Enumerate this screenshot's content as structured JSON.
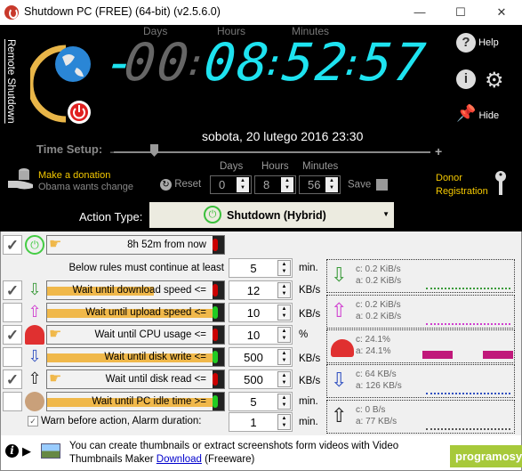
{
  "window": {
    "title": "Shutdown PC (FREE) (64-bit) (v2.5.6.0)",
    "minimize": "—",
    "maximize": "☐",
    "close": "✕"
  },
  "header": {
    "remote_shutdown": "Remote Shutdown",
    "labels": {
      "days": "Days",
      "hours": "Hours",
      "minutes": "Minutes"
    },
    "countdown": {
      "sign": "-",
      "days": "00",
      "hours": "08",
      "minutes": "52",
      "seconds": "57",
      "sep": ":"
    },
    "date": "sobota, 20 lutego 2016 23:30",
    "help": "Help",
    "hide": "Hide",
    "time_setup": "Time Setup:",
    "slider_minus": "–",
    "slider_plus": "+",
    "donation_title": "Make  a donation",
    "donation_sub": "Obama  wants change",
    "reset": "Reset",
    "spin": {
      "days_label": "Days",
      "days": "0",
      "hours_label": "Hours",
      "hours": "8",
      "minutes_label": "Minutes",
      "minutes": "56"
    },
    "save": "Save",
    "donor": "Donor",
    "registration": "Registration",
    "action_type_label": "Action Type:",
    "action_type_value": "Shutdown (Hybrid)"
  },
  "rules": {
    "timer_rule": {
      "checked": true,
      "text": "8h 52m from now",
      "status": "red"
    },
    "continue_label": "Below rules must continue at least",
    "continue_value": "5",
    "continue_unit": "min.",
    "items": [
      {
        "name": "download",
        "checked": true,
        "text": "Wait until download speed <=",
        "value": "12",
        "unit": "KB/s",
        "status": "red"
      },
      {
        "name": "upload",
        "checked": false,
        "text": "Wait until upload speed <=",
        "value": "10",
        "unit": "KB/s",
        "status": "green"
      },
      {
        "name": "cpu",
        "checked": true,
        "text": "Wait until CPU usage <=",
        "value": "10",
        "unit": "%",
        "status": "red"
      },
      {
        "name": "disk-write",
        "checked": false,
        "text": "Wait until disk write <=",
        "value": "500",
        "unit": "KB/s",
        "status": "green"
      },
      {
        "name": "disk-read",
        "checked": true,
        "text": "Wait until disk read <=",
        "value": "500",
        "unit": "KB/s",
        "status": "red"
      },
      {
        "name": "idle",
        "checked": false,
        "text": "Wait until PC idle time >=",
        "value": "5",
        "unit": "min.",
        "status": "green"
      }
    ],
    "warn_checked": true,
    "warn_label": "Warn before action, Alarm duration:",
    "warn_value": "1",
    "warn_unit": "min."
  },
  "monitors": [
    {
      "name": "download",
      "c": "c: 0.2 KiB/s",
      "a": "a: 0.2 KiB/s",
      "color": "#3a9a3a"
    },
    {
      "name": "upload",
      "c": "c: 0.2 KiB/s",
      "a": "a: 0.2 KiB/s",
      "color": "#d040d0"
    },
    {
      "name": "cpu",
      "c": "c: 24.1%",
      "a": "a: 24.1%",
      "color": "#c0187a"
    },
    {
      "name": "disk-write",
      "c": "c: 64 KB/s",
      "a": "a: 126 KB/s",
      "color": "#3050c0"
    },
    {
      "name": "disk-read",
      "c": "c: 0 B/s",
      "a": "a: 77 KB/s",
      "color": "#555555"
    }
  ],
  "footer": {
    "message": "You can create thumbnails or extract screenshots form videos with Video Thumbnails Maker",
    "link": "Download",
    "suffix": "(Freeware)",
    "watermark": "programosy.pl"
  }
}
